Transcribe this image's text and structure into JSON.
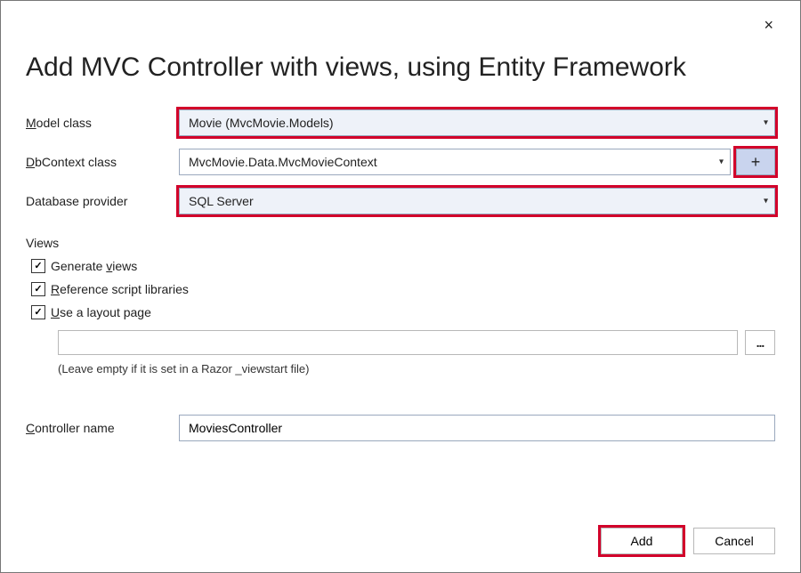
{
  "dialog": {
    "title": "Add MVC Controller with views, using Entity Framework",
    "close_label": "×"
  },
  "fields": {
    "model_class": {
      "label_pre": "",
      "label_ul": "M",
      "label_post": "odel class",
      "value": "Movie (MvcMovie.Models)"
    },
    "dbcontext_class": {
      "label_pre": "",
      "label_ul": "D",
      "label_post": "bContext class",
      "value": "MvcMovie.Data.MvcMovieContext",
      "add_label": "+"
    },
    "database_provider": {
      "label": "Database provider",
      "value": "SQL Server"
    }
  },
  "views": {
    "section_label": "Views",
    "generate_views": {
      "checked": true,
      "pre": "Generate ",
      "ul": "v",
      "post": "iews"
    },
    "reference_scripts": {
      "checked": true,
      "pre": "",
      "ul": "R",
      "post": "eference script libraries"
    },
    "use_layout": {
      "checked": true,
      "pre": "",
      "ul": "U",
      "post": "se a layout page"
    },
    "layout_path": "",
    "browse_label": "...",
    "hint": "(Leave empty if it is set in a Razor _viewstart file)"
  },
  "controller_name": {
    "label_pre": "",
    "label_ul": "C",
    "label_post": "ontroller name",
    "value": "MoviesController"
  },
  "footer": {
    "add": "Add",
    "cancel": "Cancel"
  }
}
